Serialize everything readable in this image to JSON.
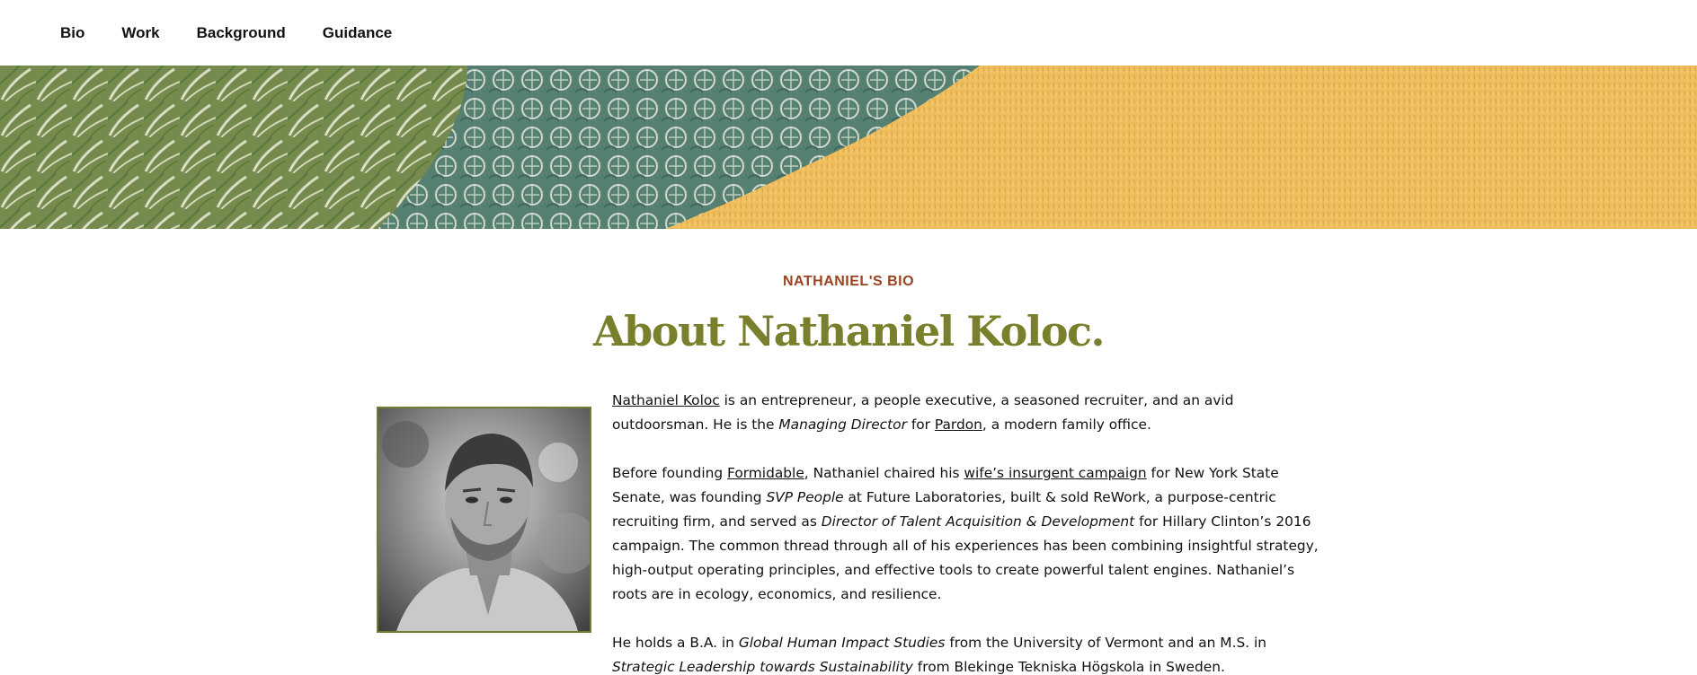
{
  "nav": {
    "items": [
      "Bio",
      "Work",
      "Background",
      "Guidance"
    ]
  },
  "hero": {
    "kicker": "NATHANIEL'S BIO",
    "title": "About Nathaniel Koloc."
  },
  "colors": {
    "kicker": "#9a4320",
    "title": "#7a7f2b",
    "banner_green": "#6f8d4e",
    "banner_teal": "#4e7f7a",
    "banner_gold": "#efbd5c",
    "portrait_border": "#737a32"
  },
  "bio": {
    "p1": {
      "name_link": "Nathaniel Koloc",
      "t1": " is an entrepreneur, a people executive, a seasoned recruiter, and an avid outdoorsman. He is the ",
      "role": "Managing Director",
      "t2": " for ",
      "company_link": "Pardon",
      "t3": ", a modern family office."
    },
    "p2": {
      "t1": "Before founding ",
      "formidable_link": "Formidable",
      "t2": ", Nathaniel chaired his ",
      "campaign_link": "wife’s insurgent campaign",
      "t3": " for New York State Senate, was founding ",
      "role1": "SVP People",
      "t4": " at Future Laboratories, built & sold ReWork, a purpose-centric recruiting firm, and served as ",
      "role2": "Director of Talent Acquisition & Development",
      "t5": " for Hillary Clinton’s 2016 campaign. The common thread through all of his experiences has been combining insightful strategy, high-output operating principles, and effective tools to create powerful talent engines. Nathaniel’s roots are in ecology, economics, and resilience."
    },
    "p3": {
      "t1": "He holds a B.A. in ",
      "degree1": "Global Human Impact Studies",
      "t2": " from the University of Vermont and an M.S. in ",
      "degree2": "Strategic Leadership towards Sustainability",
      "t3": " from Blekinge Tekniska Högskola in Sweden."
    }
  },
  "icons": {
    "banner": "botanical-illustration",
    "portrait": "portrait-photo"
  }
}
